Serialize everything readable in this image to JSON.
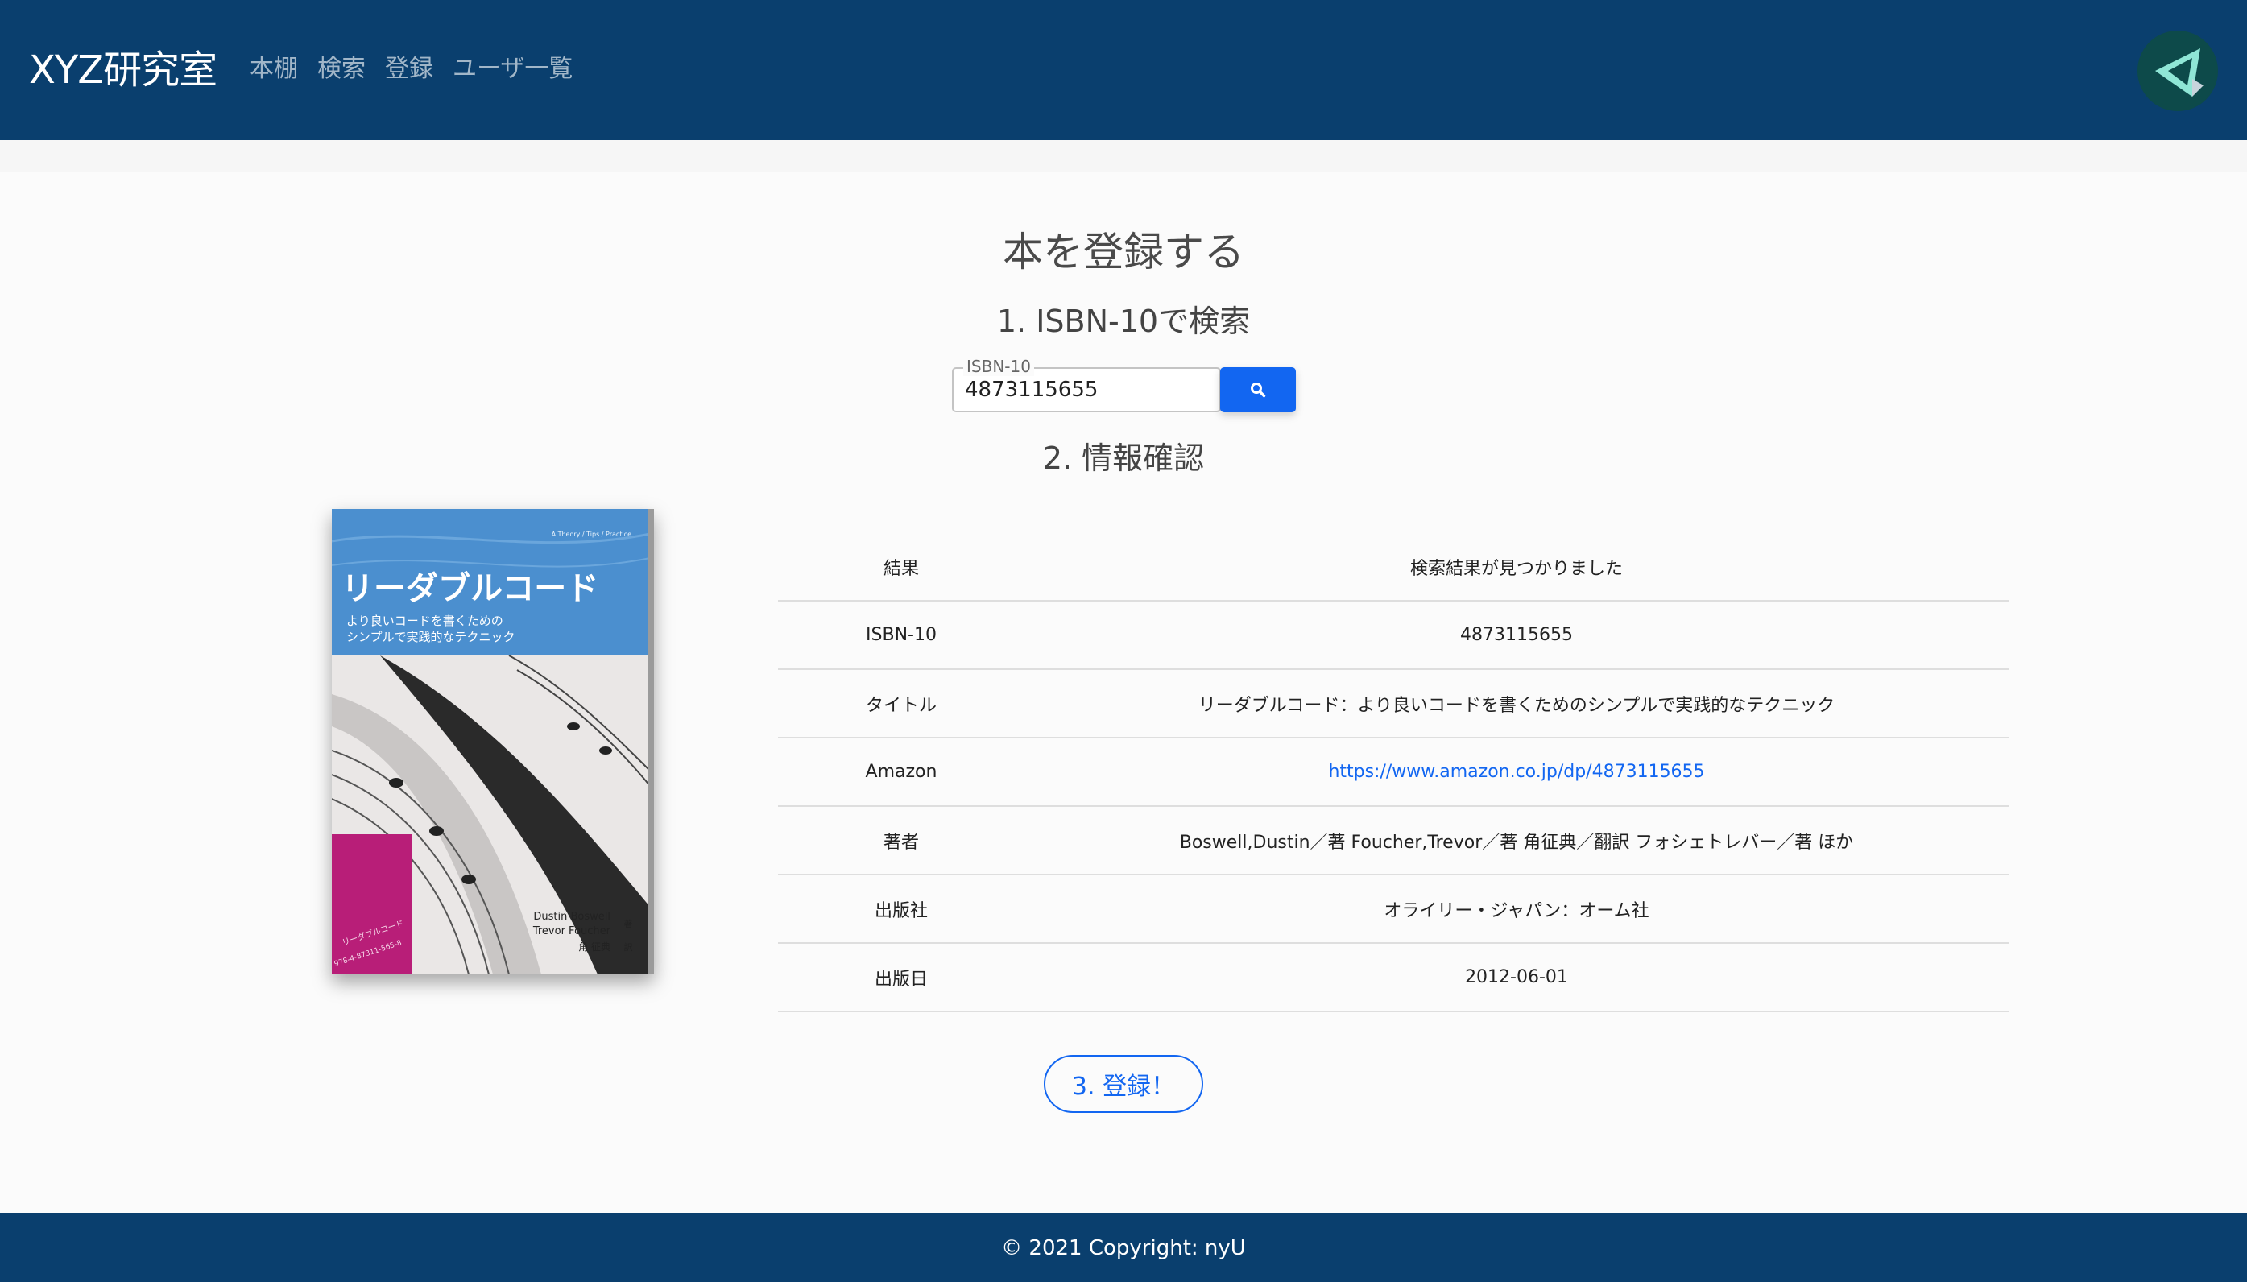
{
  "navbar": {
    "brand": "XYZ研究室",
    "links": [
      "本棚",
      "検索",
      "登録",
      "ユーザ一覧"
    ]
  },
  "page": {
    "title": "本を登録する",
    "step1": "1. ISBN-10で検索",
    "step2": "2. 情報確認"
  },
  "search": {
    "label": "ISBN-10",
    "value": "4873115655"
  },
  "book_cover": {
    "series": "A Theory / Tips / Practice",
    "title": "リーダブルコード",
    "subtitle_line1": "より良いコードを書くための",
    "subtitle_line2": "シンプルで実践的なテクニック",
    "author1": "Dustin Boswell",
    "author2": "Trevor Foucher",
    "author_mark": "著",
    "translator": "角 征典",
    "translator_mark": "訳",
    "spine_title": "リーダブルコード",
    "spine_isbn": "978-4-87311-565-8"
  },
  "table": {
    "rows": [
      {
        "key": "結果",
        "value": "検索結果が見つかりました"
      },
      {
        "key": "ISBN-10",
        "value": "4873115655"
      },
      {
        "key": "タイトル",
        "value": "リーダブルコード：より良いコードを書くためのシンプルで実践的なテクニック"
      },
      {
        "key": "Amazon",
        "value": "https://www.amazon.co.jp/dp/4873115655"
      },
      {
        "key": "著者",
        "value": "Boswell,Dustin／著 Foucher,Trevor／著 角征典／翻訳 フォシェトレバー／著 ほか"
      },
      {
        "key": "出版社",
        "value": "オライリー・ジャパン：オーム社"
      },
      {
        "key": "出版日",
        "value": "2012-06-01"
      }
    ]
  },
  "register_button": "3. 登録！",
  "footer": "© 2021 Copyright: nyU",
  "colors": {
    "navbar": "#0a3f6e",
    "primary": "#1266f1",
    "cover_blue": "#4b8fcf",
    "cover_magenta": "#b81e78"
  },
  "icons": {
    "search": "search-icon",
    "avatar": "triangle-logo-icon"
  }
}
